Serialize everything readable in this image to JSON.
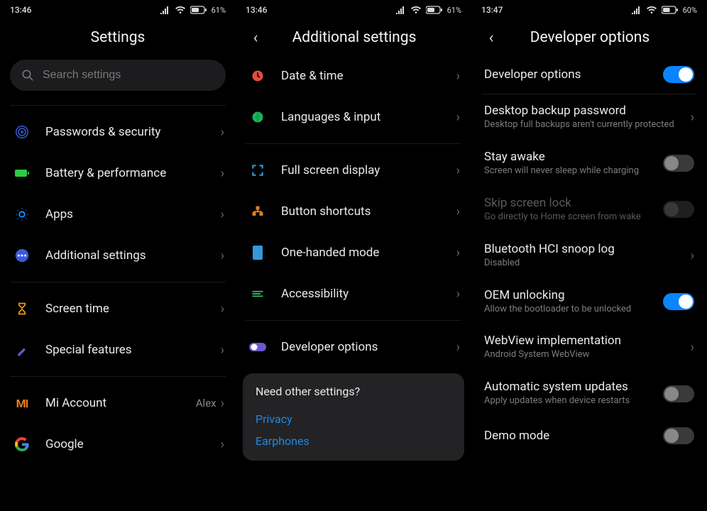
{
  "pane1": {
    "status": {
      "time": "13:46",
      "battery": "61%"
    },
    "title": "Settings",
    "search_placeholder": "Search settings",
    "groups": [
      {
        "items": [
          {
            "key": "passwords",
            "label": "Passwords & security"
          },
          {
            "key": "battery",
            "label": "Battery & performance"
          },
          {
            "key": "apps",
            "label": "Apps"
          },
          {
            "key": "additional",
            "label": "Additional settings"
          }
        ]
      },
      {
        "items": [
          {
            "key": "screentime",
            "label": "Screen time"
          },
          {
            "key": "special",
            "label": "Special features"
          }
        ]
      },
      {
        "items": [
          {
            "key": "miaccount",
            "label": "Mi Account",
            "value": "Alex"
          },
          {
            "key": "google",
            "label": "Google"
          }
        ]
      }
    ]
  },
  "pane2": {
    "status": {
      "time": "13:46",
      "battery": "61%"
    },
    "title": "Additional settings",
    "groups": [
      {
        "items": [
          {
            "key": "datetime",
            "label": "Date & time"
          },
          {
            "key": "lang",
            "label": "Languages & input"
          }
        ]
      },
      {
        "items": [
          {
            "key": "fullscreen",
            "label": "Full screen display"
          },
          {
            "key": "buttons",
            "label": "Button shortcuts"
          },
          {
            "key": "onehand",
            "label": "One-handed mode"
          },
          {
            "key": "a11y",
            "label": "Accessibility"
          }
        ]
      },
      {
        "items": [
          {
            "key": "devopts",
            "label": "Developer options"
          }
        ]
      }
    ],
    "card": {
      "title": "Need other settings?",
      "links": [
        {
          "key": "privacy",
          "label": "Privacy"
        },
        {
          "key": "earphones",
          "label": "Earphones"
        }
      ]
    }
  },
  "pane3": {
    "status": {
      "time": "13:47",
      "battery": "60%"
    },
    "title": "Developer options",
    "items": [
      {
        "key": "devopts_toggle",
        "label": "Developer options",
        "control": "toggle",
        "on": true
      },
      {
        "key": "desktop_backup",
        "label": "Desktop backup password",
        "sub": "Desktop full backups aren't currently protected",
        "control": "chevron"
      },
      {
        "key": "stay_awake",
        "label": "Stay awake",
        "sub": "Screen will never sleep while charging",
        "control": "toggle",
        "on": false
      },
      {
        "key": "skip_lock",
        "label": "Skip screen lock",
        "sub": "Go directly to Home screen from wake",
        "control": "toggle",
        "on": false,
        "disabled": true
      },
      {
        "key": "bt_hci",
        "label": "Bluetooth HCI snoop log",
        "sub": "Disabled",
        "control": "chevron"
      },
      {
        "key": "oem_unlock",
        "label": "OEM unlocking",
        "sub": "Allow the bootloader to be unlocked",
        "control": "toggle",
        "on": true
      },
      {
        "key": "webview",
        "label": "WebView implementation",
        "sub": "Android System WebView",
        "control": "chevron"
      },
      {
        "key": "auto_updates",
        "label": "Automatic system updates",
        "sub": "Apply updates when device restarts",
        "control": "toggle",
        "on": false
      },
      {
        "key": "demo_mode",
        "label": "Demo mode",
        "control": "toggle",
        "on": false
      }
    ]
  }
}
